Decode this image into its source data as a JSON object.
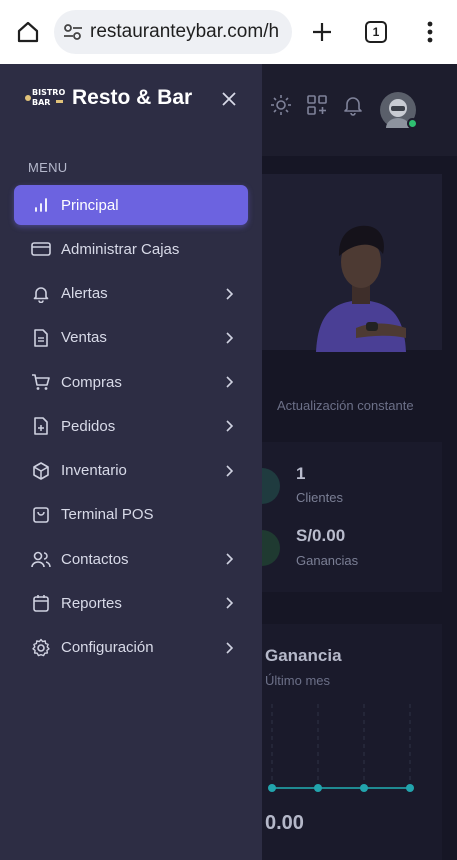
{
  "browser": {
    "url": "restauranteybar.com/h",
    "tab_count": "1"
  },
  "brand": {
    "logo_line1": "BISTRO",
    "logo_line2": "BAR",
    "name": "Resto & Bar"
  },
  "menu": {
    "heading": "MENU",
    "items": [
      {
        "label": "Principal",
        "icon": "chart-bars-icon",
        "active": true,
        "has_submenu": false
      },
      {
        "label": "Administrar Cajas",
        "icon": "credit-card-icon",
        "active": false,
        "has_submenu": false
      },
      {
        "label": "Alertas",
        "icon": "bell-icon",
        "active": false,
        "has_submenu": true
      },
      {
        "label": "Ventas",
        "icon": "document-icon",
        "active": false,
        "has_submenu": true
      },
      {
        "label": "Compras",
        "icon": "cart-icon",
        "active": false,
        "has_submenu": true
      },
      {
        "label": "Pedidos",
        "icon": "file-plus-icon",
        "active": false,
        "has_submenu": true
      },
      {
        "label": "Inventario",
        "icon": "box-icon",
        "active": false,
        "has_submenu": true
      },
      {
        "label": "Terminal POS",
        "icon": "shopping-bag-icon",
        "active": false,
        "has_submenu": false
      },
      {
        "label": "Contactos",
        "icon": "users-icon",
        "active": false,
        "has_submenu": true
      },
      {
        "label": "Reportes",
        "icon": "calendar-icon",
        "active": false,
        "has_submenu": true
      },
      {
        "label": "Configuración",
        "icon": "gear-icon",
        "active": false,
        "has_submenu": true
      }
    ]
  },
  "background_page": {
    "caption": "Actualización constante",
    "stats": [
      {
        "value": "1",
        "label": "Clientes"
      },
      {
        "value": "S/0.00",
        "label": "Ganancias"
      }
    ],
    "profit_card": {
      "title": "Ganancia",
      "subtitle": "Último mes",
      "total": "0.00"
    }
  },
  "colors": {
    "drawer_bg": "#2d2d44",
    "accent": "#6c63e0",
    "page_bg": "#161625",
    "online_status": "#2fbf71"
  }
}
